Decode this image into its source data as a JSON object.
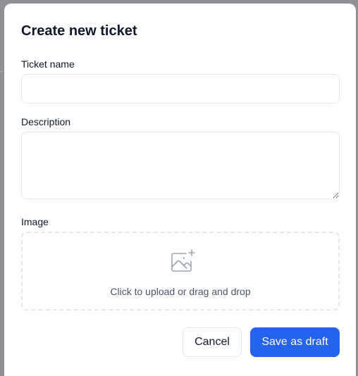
{
  "dialog": {
    "title": "Create new ticket"
  },
  "form": {
    "ticket_name": {
      "label": "Ticket name",
      "value": "",
      "placeholder": ""
    },
    "description": {
      "label": "Description",
      "value": "",
      "placeholder": ""
    },
    "image": {
      "label": "Image",
      "hint": "Click to upload or drag and drop",
      "icon": "image-upload-icon"
    }
  },
  "actions": {
    "cancel_label": "Cancel",
    "save_label": "Save as draft"
  },
  "colors": {
    "primary": "#2563eb",
    "overlay": "#8f9194",
    "border": "#e5e7eb"
  }
}
